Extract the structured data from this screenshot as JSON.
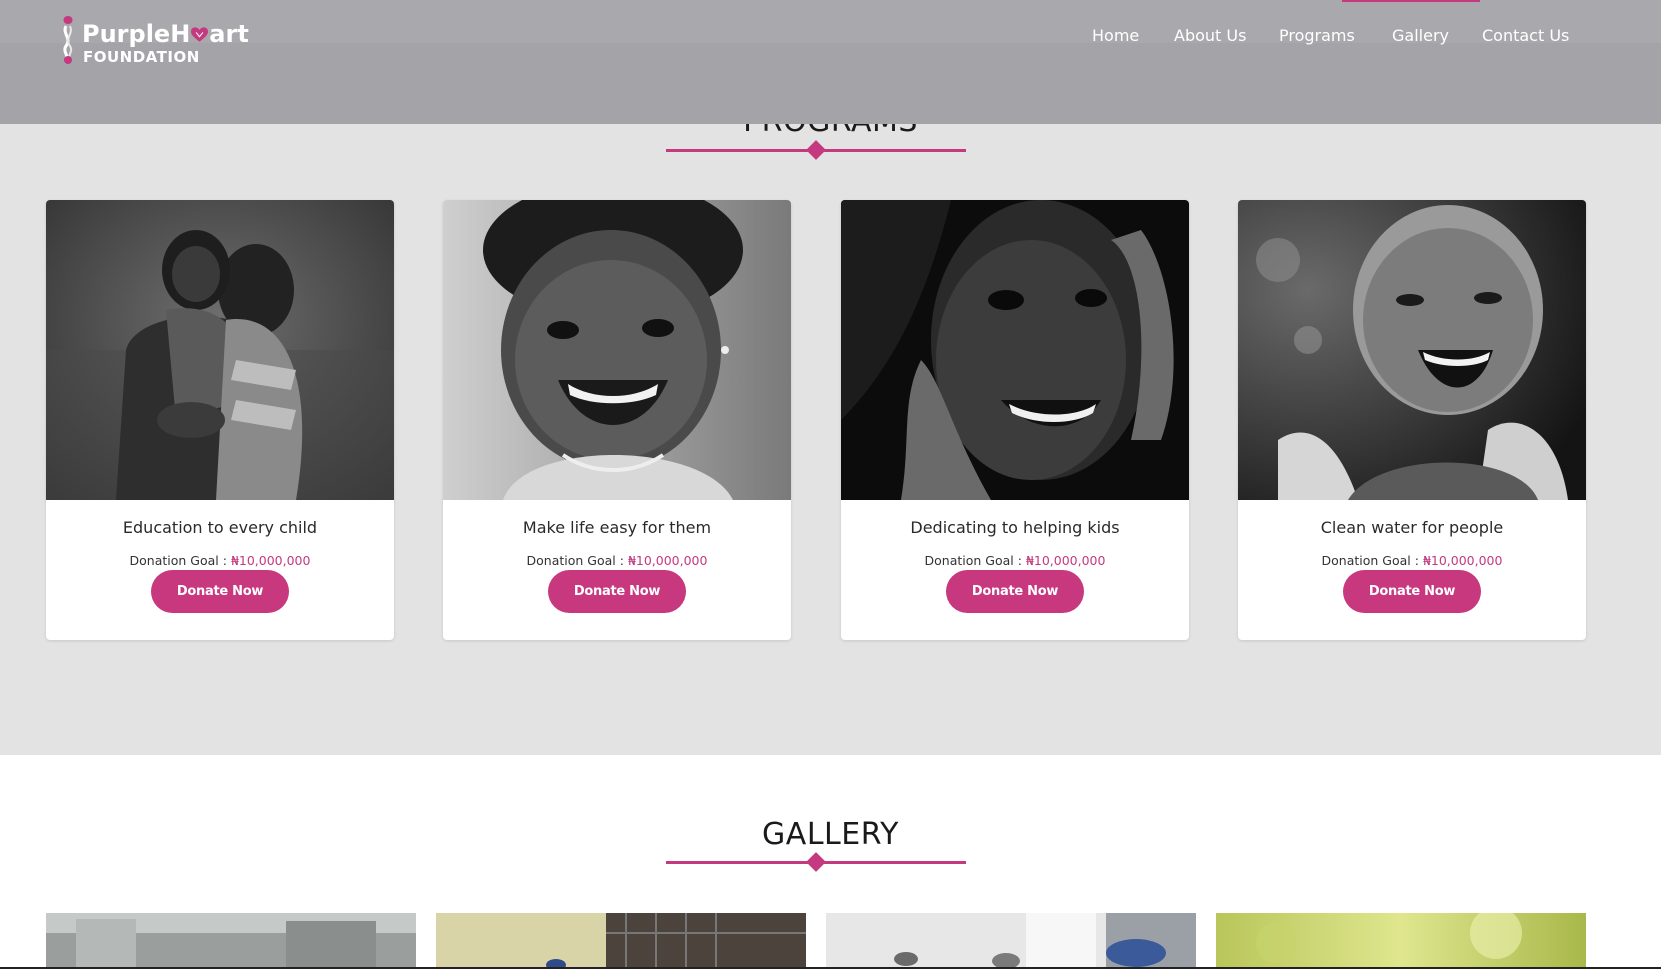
{
  "header": {
    "logo": {
      "line1_a": "PurpleH",
      "line1_b": "art",
      "line2": "FOUNDATION",
      "full": "PurpleHeart FOUNDATION"
    },
    "nav": [
      "Home",
      "About Us",
      "Programs",
      "Gallery",
      "Contact Us"
    ]
  },
  "colors": {
    "accent": "#c4397f",
    "header_bg": "#a4a3a7",
    "section_bg": "#e3e3e3"
  },
  "programs": {
    "title": "PROGRAMS",
    "cards": [
      {
        "title": "Education to every child",
        "goal_label": "Donation Goal : ",
        "goal_amount": "₦10,000,000",
        "button": "Donate Now",
        "image": "two-girls-hugging-photo"
      },
      {
        "title": "Make life easy for them",
        "goal_label": "Donation Goal : ",
        "goal_amount": "₦10,000,000",
        "button": "Donate Now",
        "image": "smiling-toddler-photo"
      },
      {
        "title": "Dedicating to helping kids",
        "goal_label": "Donation Goal : ",
        "goal_amount": "₦10,000,000",
        "button": "Donate Now",
        "image": "girl-hands-on-face-photo"
      },
      {
        "title": "Clean water for people",
        "goal_label": "Donation Goal : ",
        "goal_amount": "₦10,000,000",
        "button": "Donate Now",
        "image": "laughing-child-water-photo"
      }
    ]
  },
  "gallery": {
    "title": "GALLERY",
    "images": [
      "gallery-photo-1",
      "gallery-photo-2",
      "gallery-photo-3",
      "gallery-photo-4"
    ]
  }
}
